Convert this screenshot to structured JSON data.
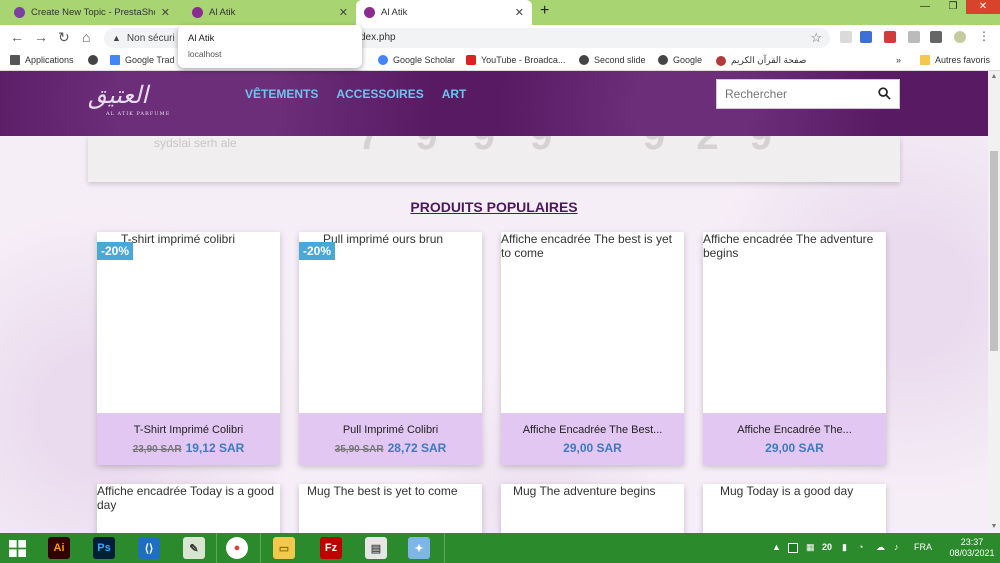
{
  "browser": {
    "tabs": [
      {
        "title": "Create New Topic - PrestaShop F",
        "favicon_color": "#7a3fa0",
        "active": false
      },
      {
        "title": "Al Atik",
        "favicon_color": "#8a2d8f",
        "active": false
      },
      {
        "title": "Al Atik",
        "favicon_color": "#8a2d8f",
        "active": true
      }
    ],
    "new_tab": "+",
    "window_controls": {
      "minimize": "—",
      "maximize": "❐",
      "close": "✕"
    },
    "nav": {
      "back": "←",
      "forward": "→",
      "reload": "↻",
      "home": "⌂"
    },
    "address": {
      "security_icon": "warning-triangle-icon",
      "security_text": "Non sécuri",
      "url_text": "dex.php",
      "bookmark_icon": "star-icon"
    },
    "tooltip": {
      "title": "Al Atik",
      "subtitle": "localhost"
    },
    "bookmarks": [
      {
        "label": "Applications",
        "icon": "apps-grid-icon",
        "color": "#555"
      },
      {
        "label": "",
        "icon": "globe-icon",
        "color": "#444"
      },
      {
        "label": "Google Trad",
        "icon": "google-translate-icon",
        "color": "#4285f4"
      },
      {
        "label": "Google Scholar",
        "icon": "scholar-icon",
        "color": "#4285f4"
      },
      {
        "label": "YouTube - Broadca...",
        "icon": "youtube-icon",
        "color": "#e02020"
      },
      {
        "label": "Second slide",
        "icon": "globe-icon",
        "color": "#444"
      },
      {
        "label": "Google",
        "icon": "globe-icon",
        "color": "#444"
      },
      {
        "label": "صفحة القرآن الكريم",
        "icon": "quran-icon",
        "color": "#b23a3a"
      }
    ],
    "bookmarks_more": "»",
    "other_bookmarks": "Autres favoris"
  },
  "site": {
    "logo_text": "العتيق",
    "logo_sub": "AL ATIK PARFUME",
    "menu": [
      "VÊTEMENTS",
      "ACCESSOIRES",
      "ART"
    ],
    "search_placeholder": "Rechercher",
    "top_faded_text": "sydslai serh ale",
    "top_big1": "7 9 9 9",
    "top_big2": "9 2 9"
  },
  "section_title": "PRODUITS POPULAIRES",
  "products": [
    {
      "alt": "T-shirt imprimé colibri",
      "badge": "-20%",
      "name": "T-Shirt Imprimé Colibri",
      "old_price": "23,90 SAR",
      "price": "19,12 SAR"
    },
    {
      "alt": "Pull imprimé ours brun",
      "badge": "-20%",
      "name": "Pull Imprimé Colibri",
      "old_price": "35,90 SAR",
      "price": "28,72 SAR"
    },
    {
      "alt": "Affiche encadrée The best is yet to come",
      "badge": "",
      "name": "Affiche Encadrée The Best...",
      "old_price": "",
      "price": "29,00 SAR"
    },
    {
      "alt": "Affiche encadrée The adventure begins",
      "badge": "",
      "name": "Affiche Encadrée The...",
      "old_price": "",
      "price": "29,00 SAR"
    }
  ],
  "products_row2": [
    {
      "alt": "Affiche encadrée Today is a good day"
    },
    {
      "alt": "Mug The best is yet to come"
    },
    {
      "alt": "Mug The adventure begins"
    },
    {
      "alt": "Mug Today is a good day"
    }
  ],
  "taskbar": {
    "apps": [
      {
        "name": "illustrator",
        "label": "Ai",
        "bg": "#330000",
        "fg": "#ff9a00"
      },
      {
        "name": "photoshop",
        "label": "Ps",
        "bg": "#001e36",
        "fg": "#31a8ff"
      },
      {
        "name": "vscode",
        "label": "⟨⟩",
        "bg": "#1f6fbf",
        "fg": "#ffffff"
      },
      {
        "name": "notepad",
        "label": "✎",
        "bg": "#d8e6d0",
        "fg": "#333333"
      },
      {
        "name": "chrome",
        "label": "●",
        "bg": "#ffffff",
        "fg": "#db4437"
      },
      {
        "name": "explorer",
        "label": "▭",
        "bg": "#f2c94c",
        "fg": "#8a6d00"
      },
      {
        "name": "filezilla",
        "label": "Fz",
        "bg": "#bf0000",
        "fg": "#ffffff"
      },
      {
        "name": "server",
        "label": "▤",
        "bg": "#e6e6e6",
        "fg": "#555555"
      },
      {
        "name": "paint",
        "label": "✦",
        "bg": "#7eb6e8",
        "fg": "#ffffff"
      }
    ],
    "tray": {
      "lang": "FRA",
      "battery_level": "20"
    },
    "time": "23:37",
    "date": "08/03/2021"
  }
}
